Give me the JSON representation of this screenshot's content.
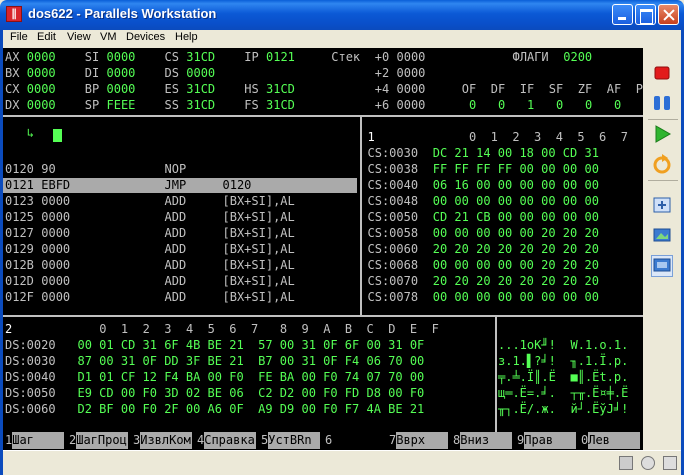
{
  "window": {
    "title": "dos622 - Parallels Workstation"
  },
  "menu": [
    "File",
    "Edit",
    "View",
    "VM",
    "Devices",
    "Help"
  ],
  "registers": [
    [
      [
        "AX",
        "0000"
      ],
      [
        "SI",
        "0000"
      ],
      [
        "CS",
        "31CD"
      ],
      [
        "IP",
        "0121"
      ]
    ],
    [
      [
        "BX",
        "0000"
      ],
      [
        "DI",
        "0000"
      ],
      [
        "DS",
        "0000"
      ]
    ],
    [
      [
        "CX",
        "0000"
      ],
      [
        "BP",
        "0000"
      ],
      [
        "ES",
        "31CD"
      ],
      [
        "HS",
        "31CD"
      ]
    ],
    [
      [
        "DX",
        "0000"
      ],
      [
        "SP",
        "FEEE"
      ],
      [
        "SS",
        "31CD"
      ],
      [
        "FS",
        "31CD"
      ]
    ]
  ],
  "stack": {
    "label": "Стек",
    "rows": [
      [
        "+0",
        "0000"
      ],
      [
        "+2",
        "0000"
      ],
      [
        "+4",
        "0000"
      ],
      [
        "+6",
        "0000"
      ]
    ]
  },
  "flags": {
    "label": "ФЛАГИ",
    "value": "0200",
    "names": [
      "OF",
      "DF",
      "IF",
      "SF",
      "ZF",
      "AF",
      "PF",
      "CF"
    ],
    "values": [
      "0",
      "0",
      "1",
      "0",
      "0",
      "0",
      "0",
      "0"
    ]
  },
  "command_prompt": "↳",
  "disasm": [
    [
      "0120",
      "90",
      "NOP",
      ""
    ],
    [
      "0121",
      "EBFD",
      "JMP",
      "0120"
    ],
    [
      "0123",
      "0000",
      "ADD",
      "[BX+SI],AL"
    ],
    [
      "0125",
      "0000",
      "ADD",
      "[BX+SI],AL"
    ],
    [
      "0127",
      "0000",
      "ADD",
      "[BX+SI],AL"
    ],
    [
      "0129",
      "0000",
      "ADD",
      "[BX+SI],AL"
    ],
    [
      "012B",
      "0000",
      "ADD",
      "[BX+SI],AL"
    ],
    [
      "012D",
      "0000",
      "ADD",
      "[BX+SI],AL"
    ],
    [
      "012F",
      "0000",
      "ADD",
      "[BX+SI],AL"
    ]
  ],
  "dump_top": {
    "number": "1",
    "columns": "0  1  2  3  4  5  6  7",
    "rows": [
      [
        "CS:0030",
        "DC 21 14 00 18 00 CD 31"
      ],
      [
        "CS:0038",
        "FF FF FF FF 00 00 00 00"
      ],
      [
        "CS:0040",
        "06 16 00 00 00 00 00 00"
      ],
      [
        "CS:0048",
        "00 00 00 00 00 00 00 00"
      ],
      [
        "CS:0050",
        "CD 21 CB 00 00 00 00 00"
      ],
      [
        "CS:0058",
        "00 00 00 00 00 20 20 20"
      ],
      [
        "CS:0060",
        "20 20 20 20 20 20 20 20"
      ],
      [
        "CS:0068",
        "00 00 00 00 00 20 20 20"
      ],
      [
        "CS:0070",
        "20 20 20 20 20 20 20 20"
      ],
      [
        "CS:0078",
        "00 00 00 00 00 00 00 00"
      ]
    ]
  },
  "dump_bottom": {
    "number": "2",
    "columns": "0  1  2  3  4  5  6  7   8  9  A  B  C  D  E  F",
    "rows": [
      [
        "DS:0020",
        "00 01 CD 31 6F 4B BE 21  57 00 31 0F 6F 00 31 0F",
        "...1oK╜!",
        "W.1.o.1."
      ],
      [
        "DS:0030",
        "87 00 31 0F DD 3F BE 21  B7 00 31 0F F4 06 70 00",
        "з.1.▌?╛!",
        "╖.1.Ї.p."
      ],
      [
        "DS:0040",
        "D1 01 CF 12 F4 BA 00 F0  FE BA 00 F0 74 07 70 00",
        "╤.╧.Ї║.Ё",
        "■║.Ёt.p."
      ],
      [
        "DS:0050",
        "E9 CD 00 F0 3D 02 BE 06  C2 D2 00 F0 FD D8 00 F0",
        "щ═.Ё=.╛.",
        "┬╥.Ё¤╪.Ё"
      ],
      [
        "DS:0060",
        "D2 BF 00 F0 2F 00 A6 0F  A9 D9 00 F0 F7 4A BE 21",
        "╥┐.Ё/.ж.",
        "й┘.ЁўJ╛!"
      ]
    ]
  },
  "fkeys": [
    [
      "1",
      "Шаг"
    ],
    [
      "2",
      "ШагПроц"
    ],
    [
      "3",
      "ИзвлКом"
    ],
    [
      "4",
      "Справка"
    ],
    [
      "5",
      "УстBRn"
    ],
    [
      "6",
      ""
    ],
    [
      "7",
      "Вврх"
    ],
    [
      "8",
      "Вниз"
    ],
    [
      "9",
      "Прав"
    ],
    [
      "0",
      "Лев"
    ]
  ]
}
